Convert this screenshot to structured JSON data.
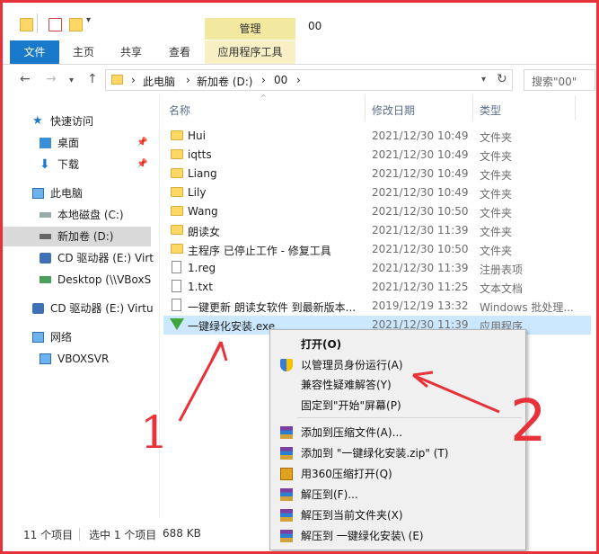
{
  "window": {
    "title": "00",
    "manage_tab": "管理"
  },
  "ribbon": {
    "tabs": [
      "文件",
      "主页",
      "共享",
      "查看",
      "应用程序工具"
    ]
  },
  "address": {
    "path": [
      "此电脑",
      "新加卷 (D:)",
      "00"
    ],
    "separator": "›",
    "search_placeholder": "搜索\"00\""
  },
  "sidebar": {
    "items": [
      {
        "label": "快速访问",
        "icon": "star-icon"
      },
      {
        "label": "桌面",
        "icon": "desktop-icon"
      },
      {
        "label": "下载",
        "icon": "download-icon"
      },
      {
        "label": "此电脑",
        "icon": "computer-icon"
      },
      {
        "label": "本地磁盘 (C:)",
        "icon": "drive-icon"
      },
      {
        "label": "新加卷 (D:)",
        "icon": "drive-icon"
      },
      {
        "label": "CD 驱动器 (E:) Virt",
        "icon": "cd-icon"
      },
      {
        "label": "Desktop (\\\\VBoxS",
        "icon": "network-drive-icon"
      },
      {
        "label": "CD 驱动器 (E:) Virtu",
        "icon": "cd-icon"
      },
      {
        "label": "网络",
        "icon": "network-icon"
      },
      {
        "label": "VBOXSVR",
        "icon": "computer-icon"
      }
    ]
  },
  "columns": {
    "name": "名称",
    "date": "修改日期",
    "type": "类型"
  },
  "files": [
    {
      "name": "Hui",
      "date": "2021/12/30 10:49",
      "type": "文件夹",
      "icon": "folder-icon"
    },
    {
      "name": "iqtts",
      "date": "2021/12/30 10:49",
      "type": "文件夹",
      "icon": "folder-icon"
    },
    {
      "name": "Liang",
      "date": "2021/12/30 10:49",
      "type": "文件夹",
      "icon": "folder-icon"
    },
    {
      "name": "Lily",
      "date": "2021/12/30 10:49",
      "type": "文件夹",
      "icon": "folder-icon"
    },
    {
      "name": "Wang",
      "date": "2021/12/30 10:50",
      "type": "文件夹",
      "icon": "folder-icon"
    },
    {
      "name": "朗读女",
      "date": "2021/12/30 11:39",
      "type": "文件夹",
      "icon": "folder-icon"
    },
    {
      "name": "主程序 已停止工作 - 修复工具",
      "date": "2021/12/30 10:50",
      "type": "文件夹",
      "icon": "folder-icon"
    },
    {
      "name": "1.reg",
      "date": "2021/12/30 11:39",
      "type": "注册表项",
      "icon": "reg-file-icon"
    },
    {
      "name": "1.txt",
      "date": "2021/12/30 11:25",
      "type": "文本文档",
      "icon": "text-file-icon"
    },
    {
      "name": "一键更新 朗读女软件 到最新版本...",
      "date": "2019/12/19 13:32",
      "type": "Windows 批处理...",
      "icon": "batch-file-icon"
    },
    {
      "name": "一键绿化安装.exe",
      "date": "2021/12/30 11:39",
      "type": "应用程序",
      "icon": "exe-icon"
    }
  ],
  "status": {
    "count": "11 个项目",
    "selected": "选中 1 个项目",
    "size": "688 KB"
  },
  "context_menu": {
    "items": [
      {
        "label": "打开(O)",
        "bold": true,
        "icon": ""
      },
      {
        "label": "以管理员身份运行(A)",
        "icon": "shield-icon"
      },
      {
        "label": "兼容性疑难解答(Y)",
        "icon": ""
      },
      {
        "label": "固定到\"开始\"屏幕(P)",
        "icon": ""
      },
      {
        "label": "添加到压缩文件(A)...",
        "icon": "winrar-icon"
      },
      {
        "label": "添加到 \"一键绿化安装.zip\" (T)",
        "icon": "winrar-icon"
      },
      {
        "label": "用360压缩打开(Q)",
        "icon": "zip-icon"
      },
      {
        "label": "解压到(F)...",
        "icon": "winrar-icon"
      },
      {
        "label": "解压到当前文件夹(X)",
        "icon": "winrar-icon"
      },
      {
        "label": "解压到 一键绿化安装\\ (E)",
        "icon": "winrar-icon"
      }
    ]
  },
  "annotations": {
    "one": "1",
    "two": "2"
  },
  "colors": {
    "annotation": "#e8323a",
    "selection": "#cce8ff",
    "file_tab": "#1979ca"
  }
}
